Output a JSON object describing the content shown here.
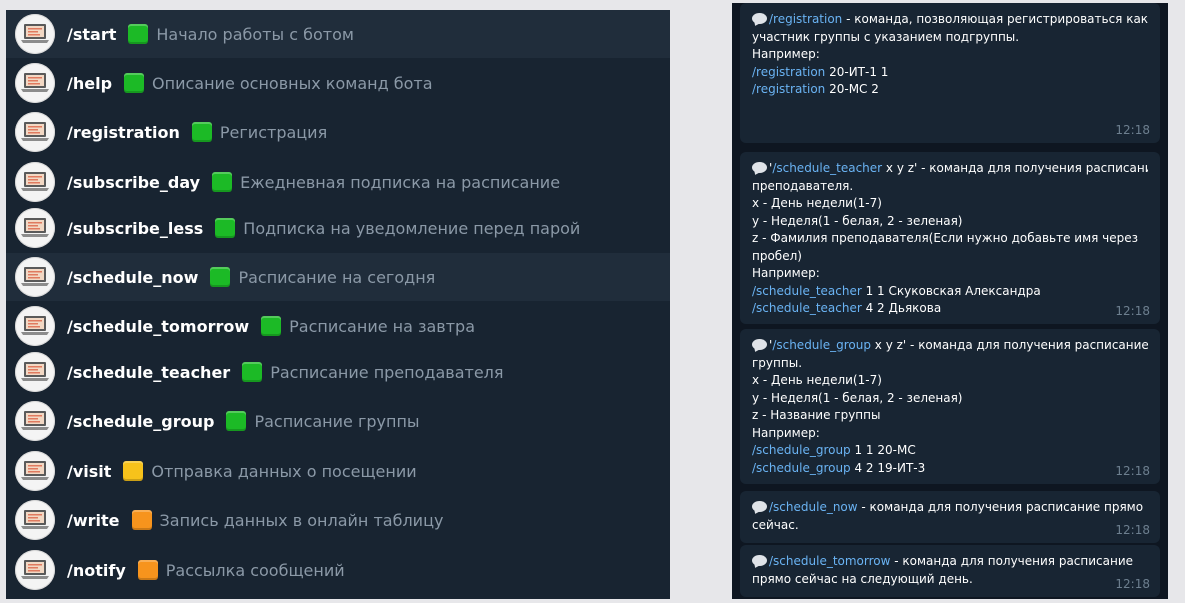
{
  "colors": {
    "green_square": "#1cba26",
    "yellow_square": "#f7c21b",
    "orange_square": "#f7941d",
    "list_bg": "#182431",
    "chat_bg": "#0e1621",
    "bubble_bg": "#182533",
    "link": "#6ab3f3"
  },
  "commands": [
    {
      "name": "/start",
      "description": "Начало работы с ботом",
      "color": "green",
      "icon": "laptop-avatar-icon"
    },
    {
      "name": "/help",
      "description": "Описание основных команд бота",
      "color": "green",
      "icon": "laptop-avatar-icon"
    },
    {
      "name": "/registration",
      "description": "Регистрация",
      "color": "green",
      "icon": "laptop-avatar-icon"
    },
    {
      "name": "/subscribe_day",
      "description": "Ежедневная подписка на расписание",
      "color": "green",
      "icon": "laptop-avatar-icon"
    },
    {
      "name": "/subscribe_less",
      "description": "Подписка на уведомление перед парой",
      "color": "green",
      "icon": "laptop-avatar-icon"
    },
    {
      "name": "/schedule_now",
      "description": "Расписание на сегодня",
      "color": "green",
      "icon": "laptop-avatar-icon"
    },
    {
      "name": "/schedule_tomorrow",
      "description": "Расписание на завтра",
      "color": "green",
      "icon": "laptop-avatar-icon"
    },
    {
      "name": "/schedule_teacher",
      "description": "Расписание преподавателя",
      "color": "green",
      "icon": "laptop-avatar-icon"
    },
    {
      "name": "/schedule_group",
      "description": "Расписание группы",
      "color": "green",
      "icon": "laptop-avatar-icon"
    },
    {
      "name": "/visit",
      "description": "Отправка данных о посещении",
      "color": "yellow",
      "icon": "laptop-avatar-icon"
    },
    {
      "name": "/write",
      "description": "Запись данных в онлайн таблицу",
      "color": "orange",
      "icon": "laptop-avatar-icon"
    },
    {
      "name": "/notify",
      "description": "Рассылка сообщений",
      "color": "orange",
      "icon": "laptop-avatar-icon"
    }
  ],
  "messages": [
    {
      "time": "12:18",
      "lines": [
        [
          {
            "t": "bubble"
          },
          {
            "t": "link",
            "v": "/registration"
          },
          {
            "t": "text",
            "v": " - команда, позволяющая регистрироваться как"
          }
        ],
        [
          {
            "t": "text",
            "v": "участник группы с указанием подгруппы."
          }
        ],
        [
          {
            "t": "text",
            "v": "Например:"
          }
        ],
        [
          {
            "t": "text",
            "v": " "
          }
        ],
        [
          {
            "t": "link",
            "v": "/registration"
          },
          {
            "t": "text",
            "v": " 20-ИТ-1 1"
          }
        ],
        [
          {
            "t": "text",
            "v": " "
          }
        ],
        [
          {
            "t": "link",
            "v": "/registration"
          },
          {
            "t": "text",
            "v": " 20-МС 2"
          }
        ]
      ]
    },
    {
      "time": "12:18",
      "lines": [
        [
          {
            "t": "bubble"
          },
          {
            "t": "text",
            "v": "'"
          },
          {
            "t": "link",
            "v": "/schedule_teacher"
          },
          {
            "t": "text",
            "v": " x y z' - команда для получения расписание"
          }
        ],
        [
          {
            "t": "text",
            "v": "преподавателя."
          }
        ],
        [
          {
            "t": "text",
            "v": "x - День недели(1-7)"
          }
        ],
        [
          {
            "t": "text",
            "v": "y - Неделя(1 - белая, 2 - зеленая)"
          }
        ],
        [
          {
            "t": "text",
            "v": "z - Фамилия преподавателя(Если нужно добавьте имя через"
          }
        ],
        [
          {
            "t": "text",
            "v": "пробел)"
          }
        ],
        [
          {
            "t": "text",
            "v": "Например:"
          }
        ],
        [
          {
            "t": "link",
            "v": "/schedule_teacher"
          },
          {
            "t": "text",
            "v": " 1 1 Скуковская Александра"
          }
        ],
        [
          {
            "t": "link",
            "v": "/schedule_teacher"
          },
          {
            "t": "text",
            "v": " 4 2 Дьякова"
          }
        ]
      ]
    },
    {
      "time": "12:18",
      "lines": [
        [
          {
            "t": "bubble"
          },
          {
            "t": "text",
            "v": "'"
          },
          {
            "t": "link",
            "v": "/schedule_group"
          },
          {
            "t": "text",
            "v": " x y z' - команда для получения расписание"
          }
        ],
        [
          {
            "t": "text",
            "v": "группы."
          }
        ],
        [
          {
            "t": "text",
            "v": "x - День недели(1-7)"
          }
        ],
        [
          {
            "t": "text",
            "v": "y - Неделя(1 - белая, 2 - зеленая)"
          }
        ],
        [
          {
            "t": "text",
            "v": "z - Название группы"
          }
        ],
        [
          {
            "t": "text",
            "v": "Например:"
          }
        ],
        [
          {
            "t": "link",
            "v": "/schedule_group"
          },
          {
            "t": "text",
            "v": " 1 1 20-МС"
          }
        ],
        [
          {
            "t": "link",
            "v": "/schedule_group"
          },
          {
            "t": "text",
            "v": " 4 2 19-ИТ-3"
          }
        ]
      ]
    },
    {
      "time": "12:18",
      "lines": [
        [
          {
            "t": "bubble"
          },
          {
            "t": "link",
            "v": "/schedule_now"
          },
          {
            "t": "text",
            "v": " - команда для получения расписание прямо"
          }
        ],
        [
          {
            "t": "text",
            "v": "сейчас."
          }
        ]
      ]
    },
    {
      "time": "12:18",
      "lines": [
        [
          {
            "t": "bubble"
          },
          {
            "t": "link",
            "v": "/schedule_tomorrow"
          },
          {
            "t": "text",
            "v": " - команда для получения расписание"
          }
        ],
        [
          {
            "t": "text",
            "v": "прямо сейчас на следующий день."
          }
        ]
      ]
    }
  ]
}
